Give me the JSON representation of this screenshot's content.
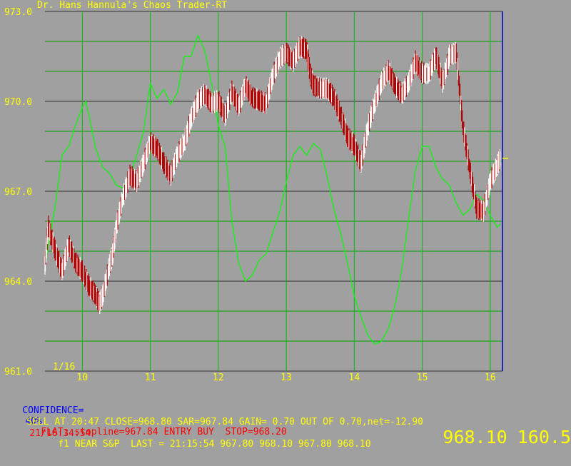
{
  "window": {
    "title": "Dr. Hans Hannula's Chaos Trader-RT"
  },
  "chart_data": {
    "type": "line",
    "title": "Dr. Hans Hannula's Chaos Trader-RT",
    "date_label": "1/16",
    "ylim": [
      961.0,
      973.0
    ],
    "y_ticks": [
      "973.0",
      "970.0",
      "967.0",
      "964.0",
      "961.0"
    ],
    "x_ticks": [
      "10",
      "11",
      "12",
      "13",
      "14",
      "15",
      "16"
    ],
    "grid": true,
    "colors": {
      "background": "#a0a0a0",
      "grid_vertical": "#00c000",
      "grid_horizontal_major": "#303030",
      "grid_horizontal_minor": "#00a000",
      "price_up": "#ffffff",
      "price_down": "#b00000",
      "cycle_line": "#00ff00",
      "last_marker": "#ffff00"
    },
    "series": [
      {
        "kind": "price",
        "x": [
          9.45,
          9.5,
          9.6,
          9.7,
          9.8,
          9.9,
          10.0,
          10.1,
          10.2,
          10.25,
          10.3,
          10.4,
          10.45,
          10.5,
          10.6,
          10.7,
          10.8,
          10.9,
          11.0,
          11.1,
          11.2,
          11.3,
          11.4,
          11.5,
          11.6,
          11.7,
          11.8,
          11.9,
          12.0,
          12.1,
          12.2,
          12.3,
          12.4,
          12.5,
          12.6,
          12.7,
          12.8,
          12.9,
          13.0,
          13.1,
          13.2,
          13.3,
          13.35,
          13.4,
          13.5,
          13.6,
          13.7,
          13.8,
          13.9,
          14.0,
          14.1,
          14.2,
          14.3,
          14.4,
          14.5,
          14.6,
          14.7,
          14.8,
          14.9,
          15.0,
          15.1,
          15.2,
          15.3,
          15.4,
          15.5,
          15.6,
          15.7,
          15.8,
          15.9,
          16.0,
          16.1,
          16.15
        ],
        "values": [
          964.5,
          965.8,
          965.0,
          964.3,
          965.2,
          964.6,
          964.3,
          963.8,
          963.5,
          963.2,
          963.5,
          964.5,
          964.9,
          965.8,
          966.8,
          967.5,
          967.3,
          967.9,
          968.6,
          968.4,
          967.9,
          967.5,
          968.2,
          968.6,
          969.4,
          970.0,
          970.2,
          969.9,
          970.0,
          969.5,
          970.3,
          969.8,
          970.5,
          970.1,
          970.0,
          969.9,
          970.8,
          971.4,
          971.6,
          971.3,
          971.8,
          971.7,
          970.9,
          970.5,
          970.4,
          970.4,
          970.1,
          969.5,
          968.8,
          968.5,
          967.9,
          969.1,
          969.9,
          970.6,
          971.0,
          970.5,
          970.2,
          970.6,
          971.3,
          970.9,
          970.9,
          971.5,
          970.6,
          971.5,
          971.6,
          969.1,
          967.7,
          966.4,
          966.3,
          967.3,
          967.8,
          968.1
        ]
      },
      {
        "kind": "cycle",
        "x": [
          9.45,
          9.5,
          9.6,
          9.7,
          9.8,
          9.9,
          10.0,
          10.05,
          10.1,
          10.2,
          10.3,
          10.4,
          10.5,
          10.6,
          10.7,
          10.8,
          10.9,
          11.0,
          11.1,
          11.2,
          11.3,
          11.4,
          11.5,
          11.6,
          11.7,
          11.8,
          11.9,
          12.0,
          12.1,
          12.2,
          12.3,
          12.4,
          12.5,
          12.6,
          12.7,
          12.8,
          12.9,
          13.0,
          13.1,
          13.2,
          13.3,
          13.4,
          13.5,
          13.6,
          13.7,
          13.8,
          13.9,
          14.0,
          14.1,
          14.2,
          14.3,
          14.4,
          14.5,
          14.6,
          14.7,
          14.8,
          14.9,
          15.0,
          15.1,
          15.2,
          15.3,
          15.4,
          15.5,
          15.6,
          15.7,
          15.8,
          15.9,
          16.0,
          16.1,
          16.15
        ],
        "values": [
          964.5,
          965.2,
          966.5,
          968.2,
          968.5,
          969.2,
          969.8,
          970.0,
          969.5,
          968.4,
          967.8,
          967.6,
          967.2,
          967.1,
          967.5,
          968.2,
          969.0,
          970.6,
          970.1,
          970.4,
          969.9,
          970.3,
          971.5,
          971.5,
          972.2,
          971.7,
          970.6,
          969.2,
          968.5,
          966.0,
          964.6,
          964.0,
          964.2,
          964.7,
          964.9,
          965.6,
          966.3,
          967.3,
          968.2,
          968.5,
          968.2,
          968.6,
          968.4,
          967.5,
          966.4,
          965.6,
          964.6,
          963.5,
          962.8,
          962.2,
          961.9,
          962.0,
          962.4,
          963.2,
          964.4,
          966.1,
          967.7,
          968.5,
          968.5,
          967.8,
          967.4,
          967.2,
          966.6,
          966.2,
          966.4,
          966.9,
          966.7,
          966.2,
          965.8,
          965.9
        ]
      }
    ]
  },
  "status": {
    "confidence_label": "CONFIDENCE=",
    "confidence_value": "40%",
    "flat_text": "FLAT: stopline=967.84 ENTRY BUY  STOP=968.20",
    "sell_text": "SELL AT 20:47 CLOSE=968.80 SAR=967.84 GAIN= 0.70 OUT OF 0.70,net=-12.90",
    "timestamp": "21/16:34:54",
    "quote_text": "f1 NEAR S&P  LAST = 21:15:54 967.80 968.10 967.80 968.10",
    "big_price": "968.10",
    "big_value": "160.5"
  }
}
